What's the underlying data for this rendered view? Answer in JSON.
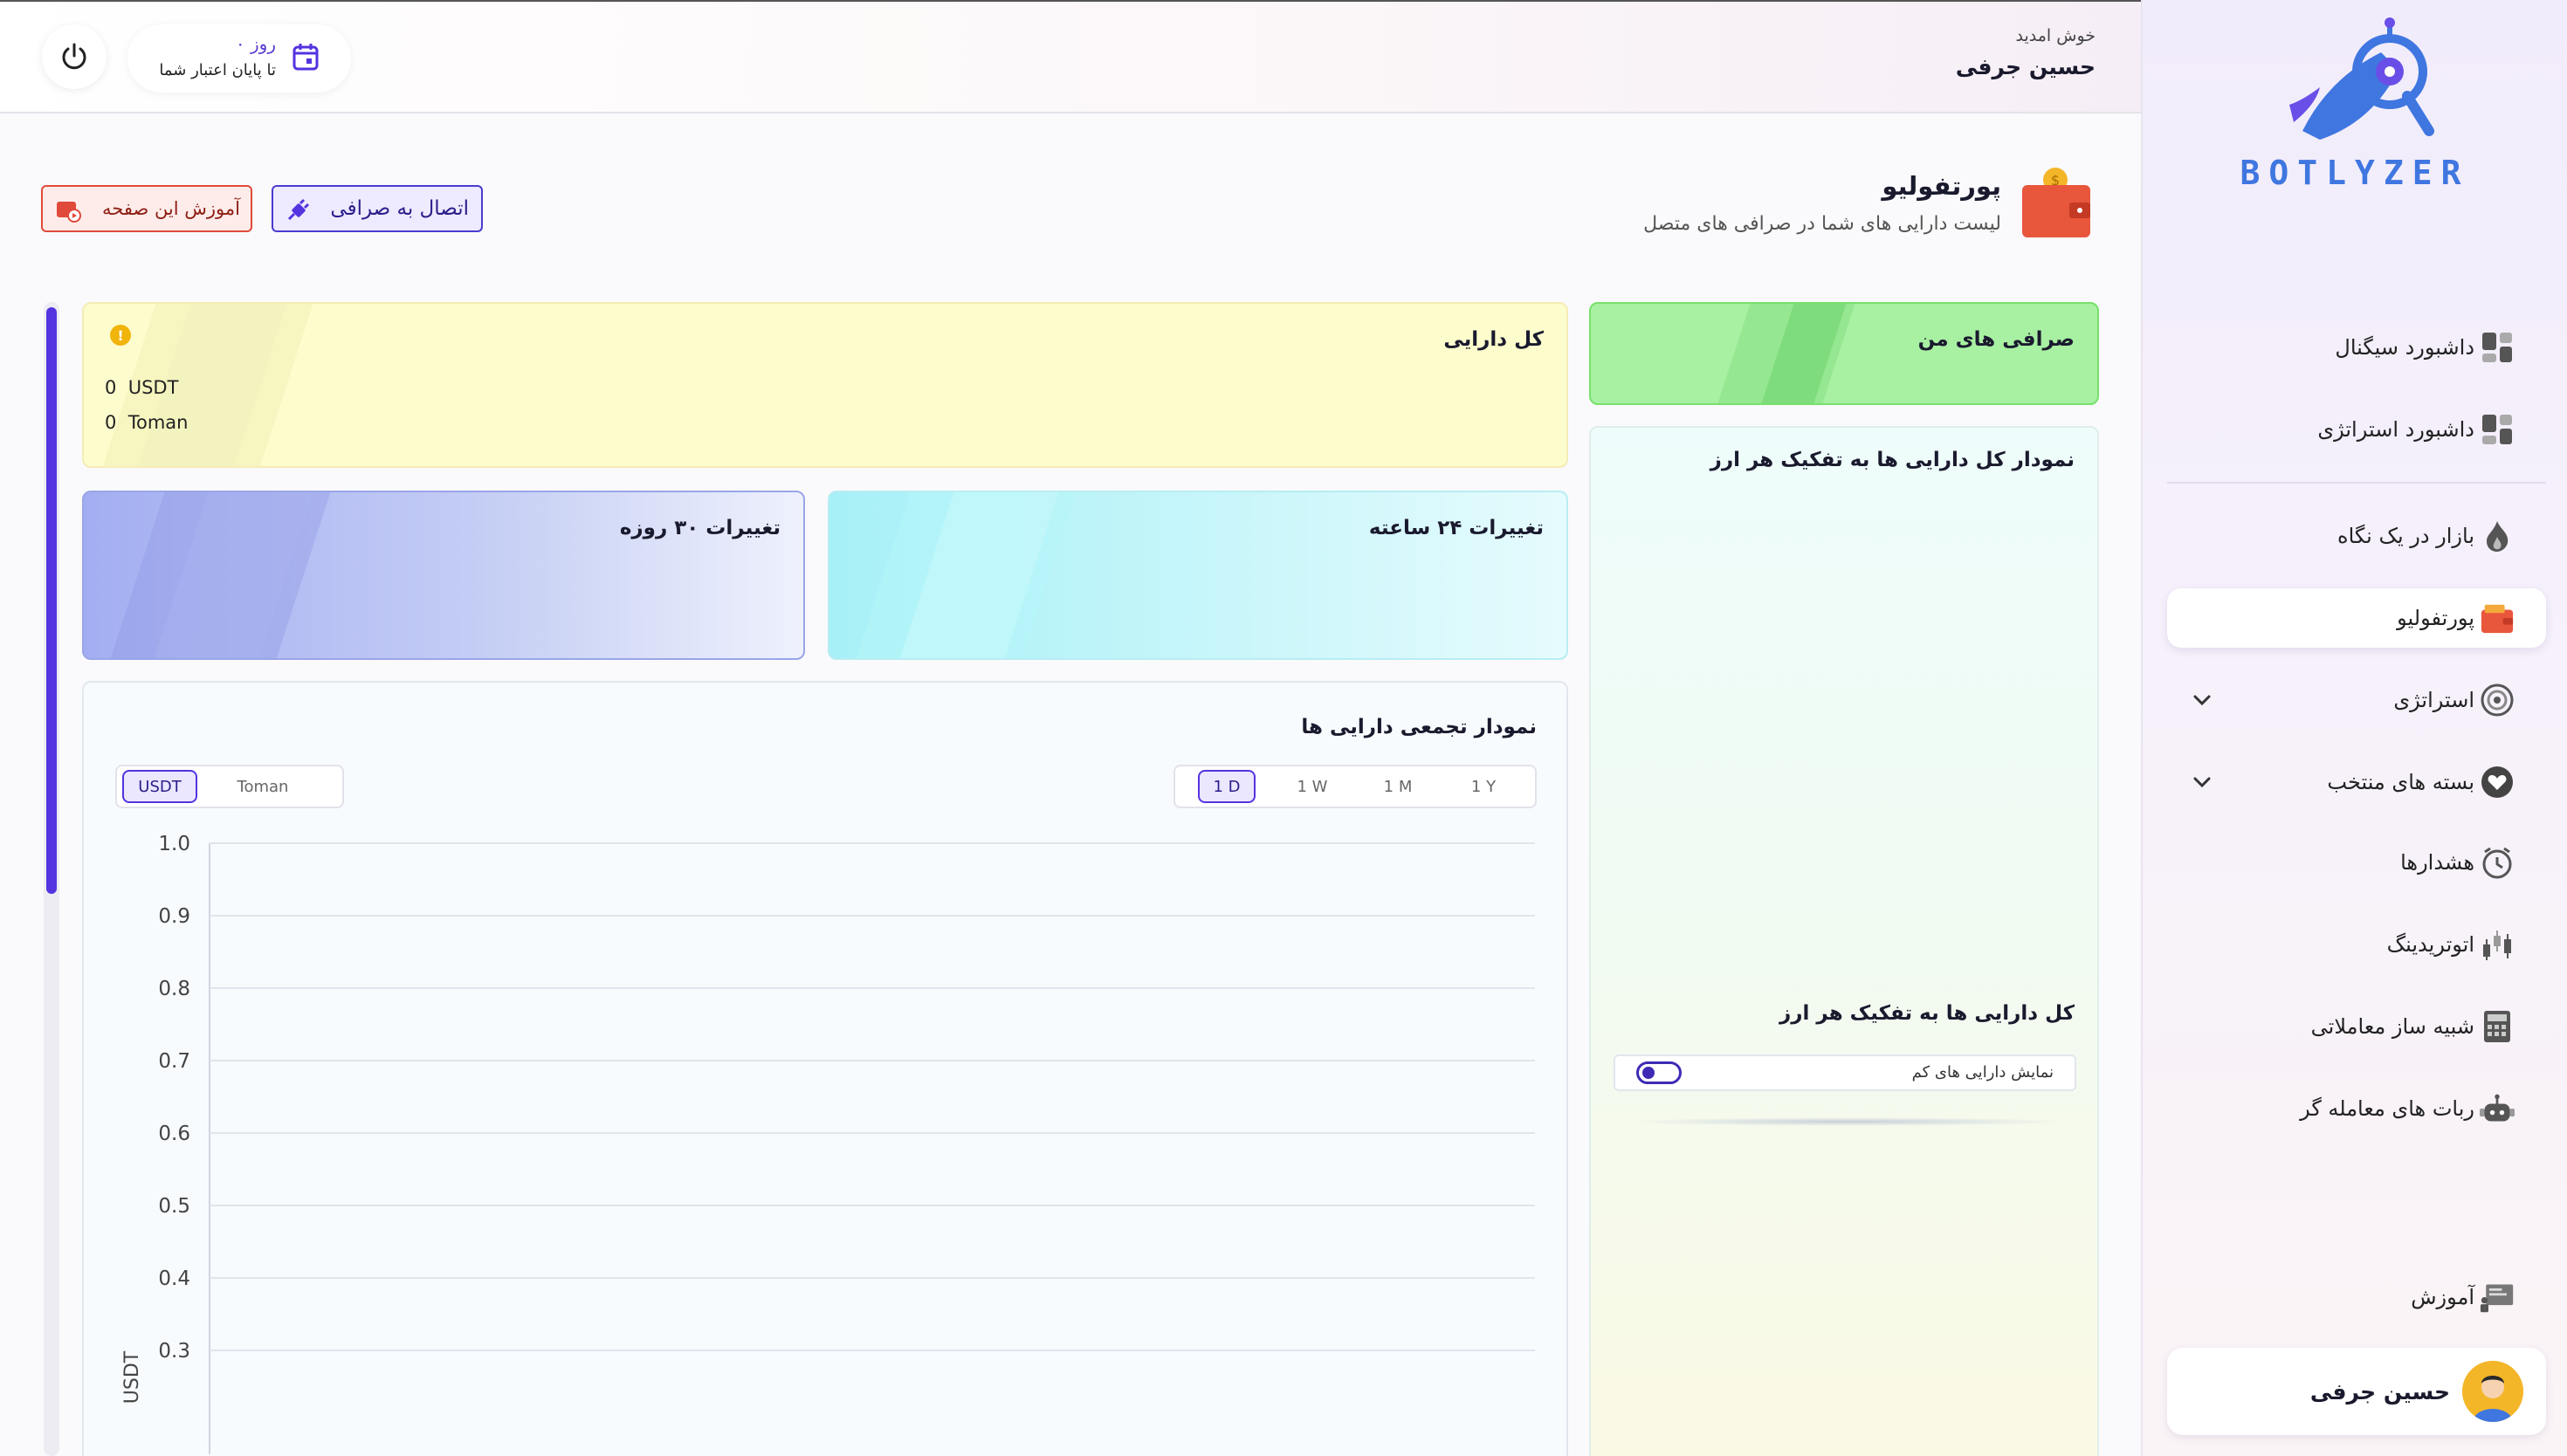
{
  "brand": {
    "name": "BOTLYZER"
  },
  "header": {
    "welcome": "خوش امدید",
    "user_name": "حسین جرفی",
    "credit_days": "۰ روز",
    "credit_text": "تا پایان اعتبار شما"
  },
  "page": {
    "title": "پورتفولیو",
    "subtitle": "لیست دارایی های شما در صرافی های متصل",
    "connect_button": "اتصال به صرافی",
    "tutorial_button": "آموزش این صفحه"
  },
  "sidebar": {
    "items": [
      {
        "label": "داشبورد سیگنال",
        "icon": "dashboard-icon"
      },
      {
        "label": "داشبورد استراتژی",
        "icon": "dashboard-icon"
      },
      {
        "label": "بازار در یک نگاه",
        "icon": "fire-icon"
      },
      {
        "label": "پورتفولیو",
        "icon": "wallet-icon",
        "active": true
      },
      {
        "label": "استراتژی",
        "icon": "target-icon",
        "expandable": true
      },
      {
        "label": "بسته های منتخب",
        "icon": "heart-icon",
        "expandable": true
      },
      {
        "label": "هشدارها",
        "icon": "alarm-clock-icon"
      },
      {
        "label": "اتوتریدینگ",
        "icon": "candlestick-icon"
      },
      {
        "label": "شبیه ساز معاملاتی",
        "icon": "calculator-icon"
      },
      {
        "label": "ربات های معامله گر",
        "icon": "robot-icon"
      }
    ],
    "learning": "آموزش",
    "profile_name": "حسین جرفی"
  },
  "total_assets": {
    "title": "کل دارایی",
    "usdt_value": "0",
    "usdt_unit": "USDT",
    "toman_value": "0",
    "toman_unit": "Toman",
    "warning_symbol": "!"
  },
  "change_24h": {
    "title": "تغییرات ۲۴ ساعته"
  },
  "change_30d": {
    "title": "تغییرات ۳۰ روزه"
  },
  "my_exchanges": {
    "title": "صرافی های من"
  },
  "breakdown": {
    "chart_title": "نمودار کل دارایی ها به تفکیک هر ارز",
    "list_title": "کل دارایی ها به تفکیک هر ارز",
    "toggle_label": "نمایش دارایی های کم",
    "toggle_on": false
  },
  "cumulative": {
    "title": "نمودار تجمعی دارایی ها",
    "currencies": [
      "USDT",
      "Toman"
    ],
    "selected_currency": "USDT",
    "ranges": [
      "1 D",
      "1 W",
      "1 M",
      "1 Y"
    ],
    "selected_range": "1 D"
  },
  "colors": {
    "accent": "#5433e0",
    "brand": "#3f76e0",
    "danger": "#e04a3a"
  },
  "chart_data": {
    "type": "line",
    "title": "نمودار تجمعی دارایی ها",
    "xlabel": "",
    "ylabel": "USDT",
    "ylim": [
      0.3,
      1.0
    ],
    "yticks": [
      "1.0",
      "0.9",
      "0.8",
      "0.7",
      "0.6",
      "0.5",
      "0.4",
      "0.3"
    ],
    "series": [],
    "grid": true
  }
}
